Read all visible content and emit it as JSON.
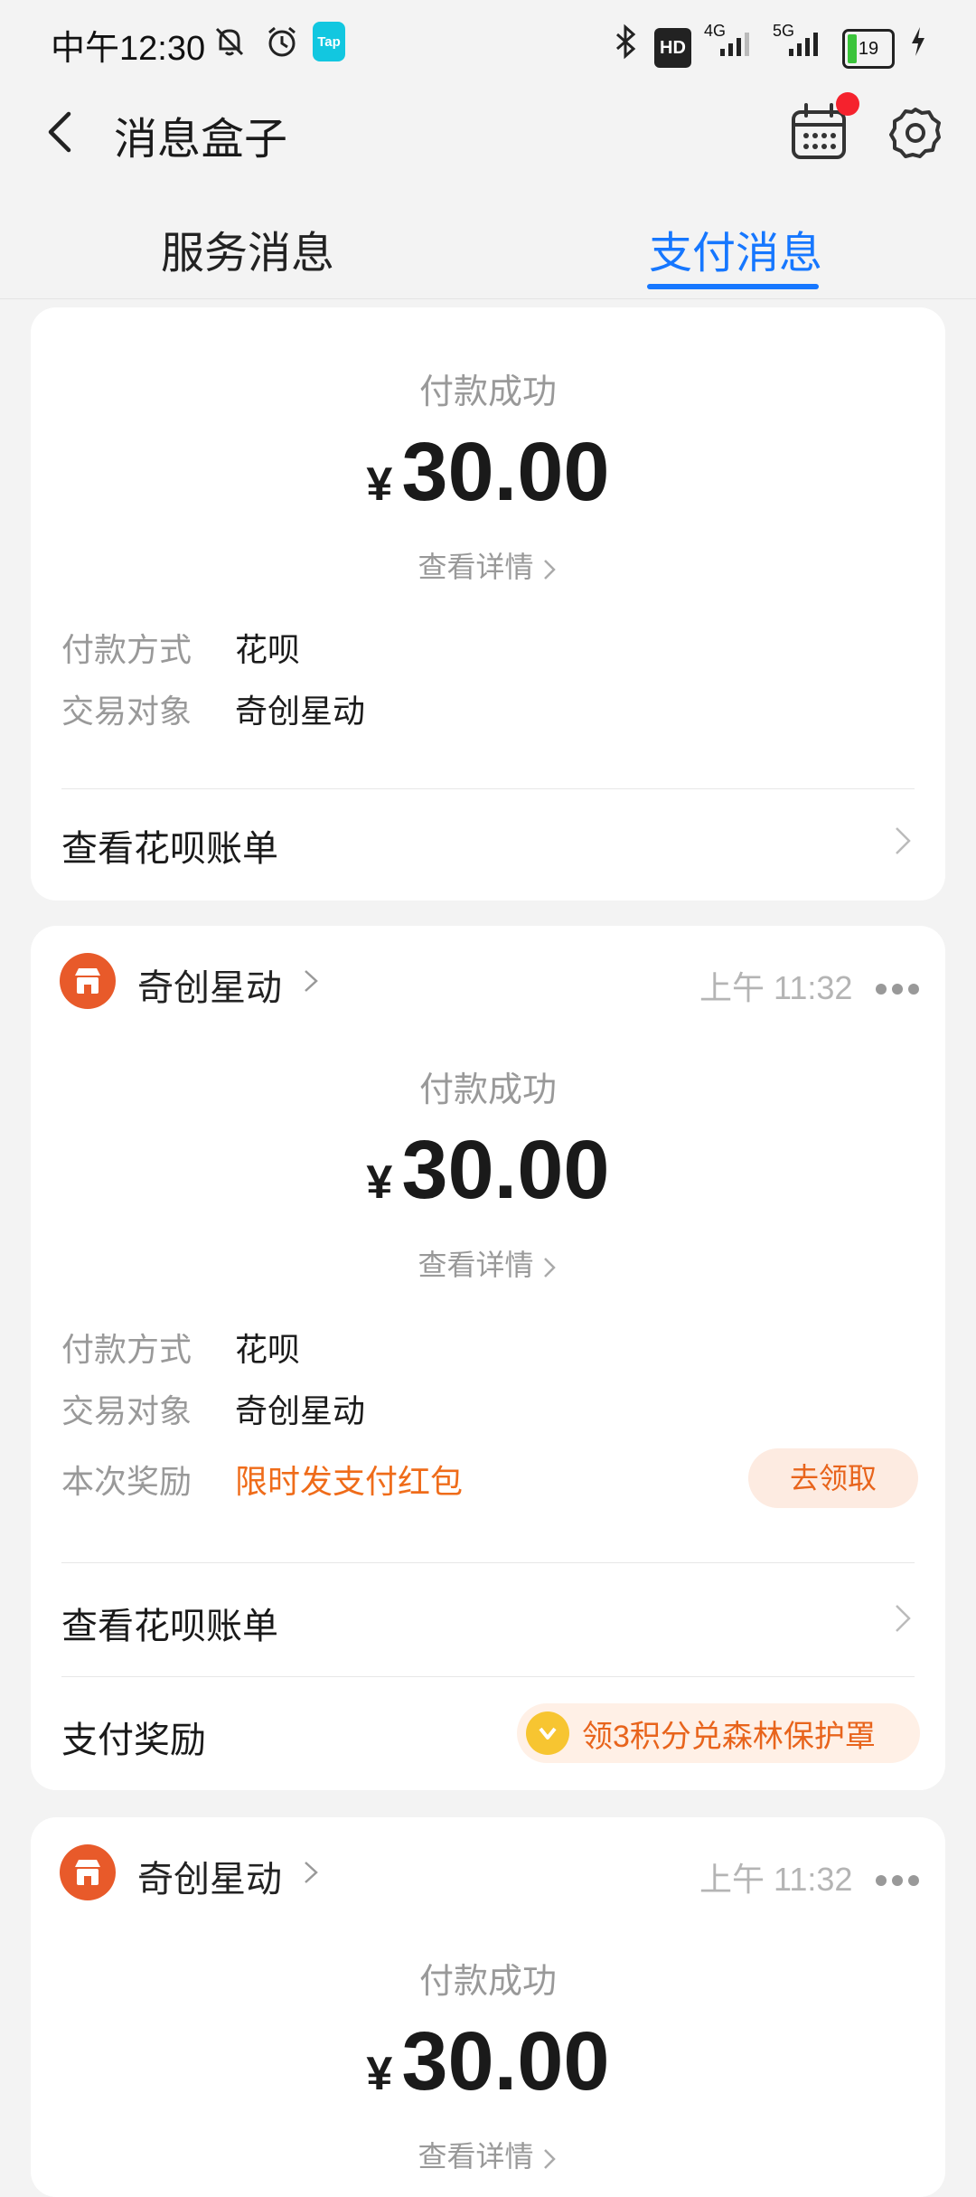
{
  "status_bar": {
    "time": "中午12:30",
    "tap_badge": "Tap",
    "hd_badge": "HD",
    "signal_1": "4G",
    "signal_2": "5G",
    "battery": "19",
    "icons": [
      "mute-bell-icon",
      "alarm-icon",
      "bluetooth-icon",
      "charging-icon"
    ]
  },
  "header": {
    "title": "消息盒子",
    "icons": [
      "back-arrow-icon",
      "calendar-icon",
      "settings-gear-icon"
    ]
  },
  "tabs": [
    {
      "label": "服务消息",
      "active": false
    },
    {
      "label": "支付消息",
      "active": true
    }
  ],
  "cards": [
    {
      "status": "付款成功",
      "currency": "¥",
      "amount": "30.00",
      "detail_link": "查看详情",
      "rows": [
        {
          "label": "付款方式",
          "value": "花呗"
        },
        {
          "label": "交易对象",
          "value": "奇创星动"
        }
      ],
      "link_row": "查看花呗账单"
    },
    {
      "merchant": "奇创星动",
      "time": "上午 11:32",
      "status": "付款成功",
      "currency": "¥",
      "amount": "30.00",
      "detail_link": "查看详情",
      "rows": [
        {
          "label": "付款方式",
          "value": "花呗"
        },
        {
          "label": "交易对象",
          "value": "奇创星动"
        },
        {
          "label": "本次奖励",
          "value": "限时发支付红包"
        }
      ],
      "claim_button": "去领取",
      "link_row": "查看花呗账单",
      "reward_label": "支付奖励",
      "reward_pill": "领3积分兑森林保护罩"
    },
    {
      "merchant": "奇创星动",
      "time": "上午 11:32",
      "status": "付款成功",
      "currency": "¥",
      "amount": "30.00",
      "detail_link": "查看详情"
    }
  ],
  "colors": {
    "accent": "#1677ff",
    "merchant_logo": "#e85a2a",
    "reward_orange": "#ef6c1a",
    "notification_dot": "#f5222d"
  }
}
